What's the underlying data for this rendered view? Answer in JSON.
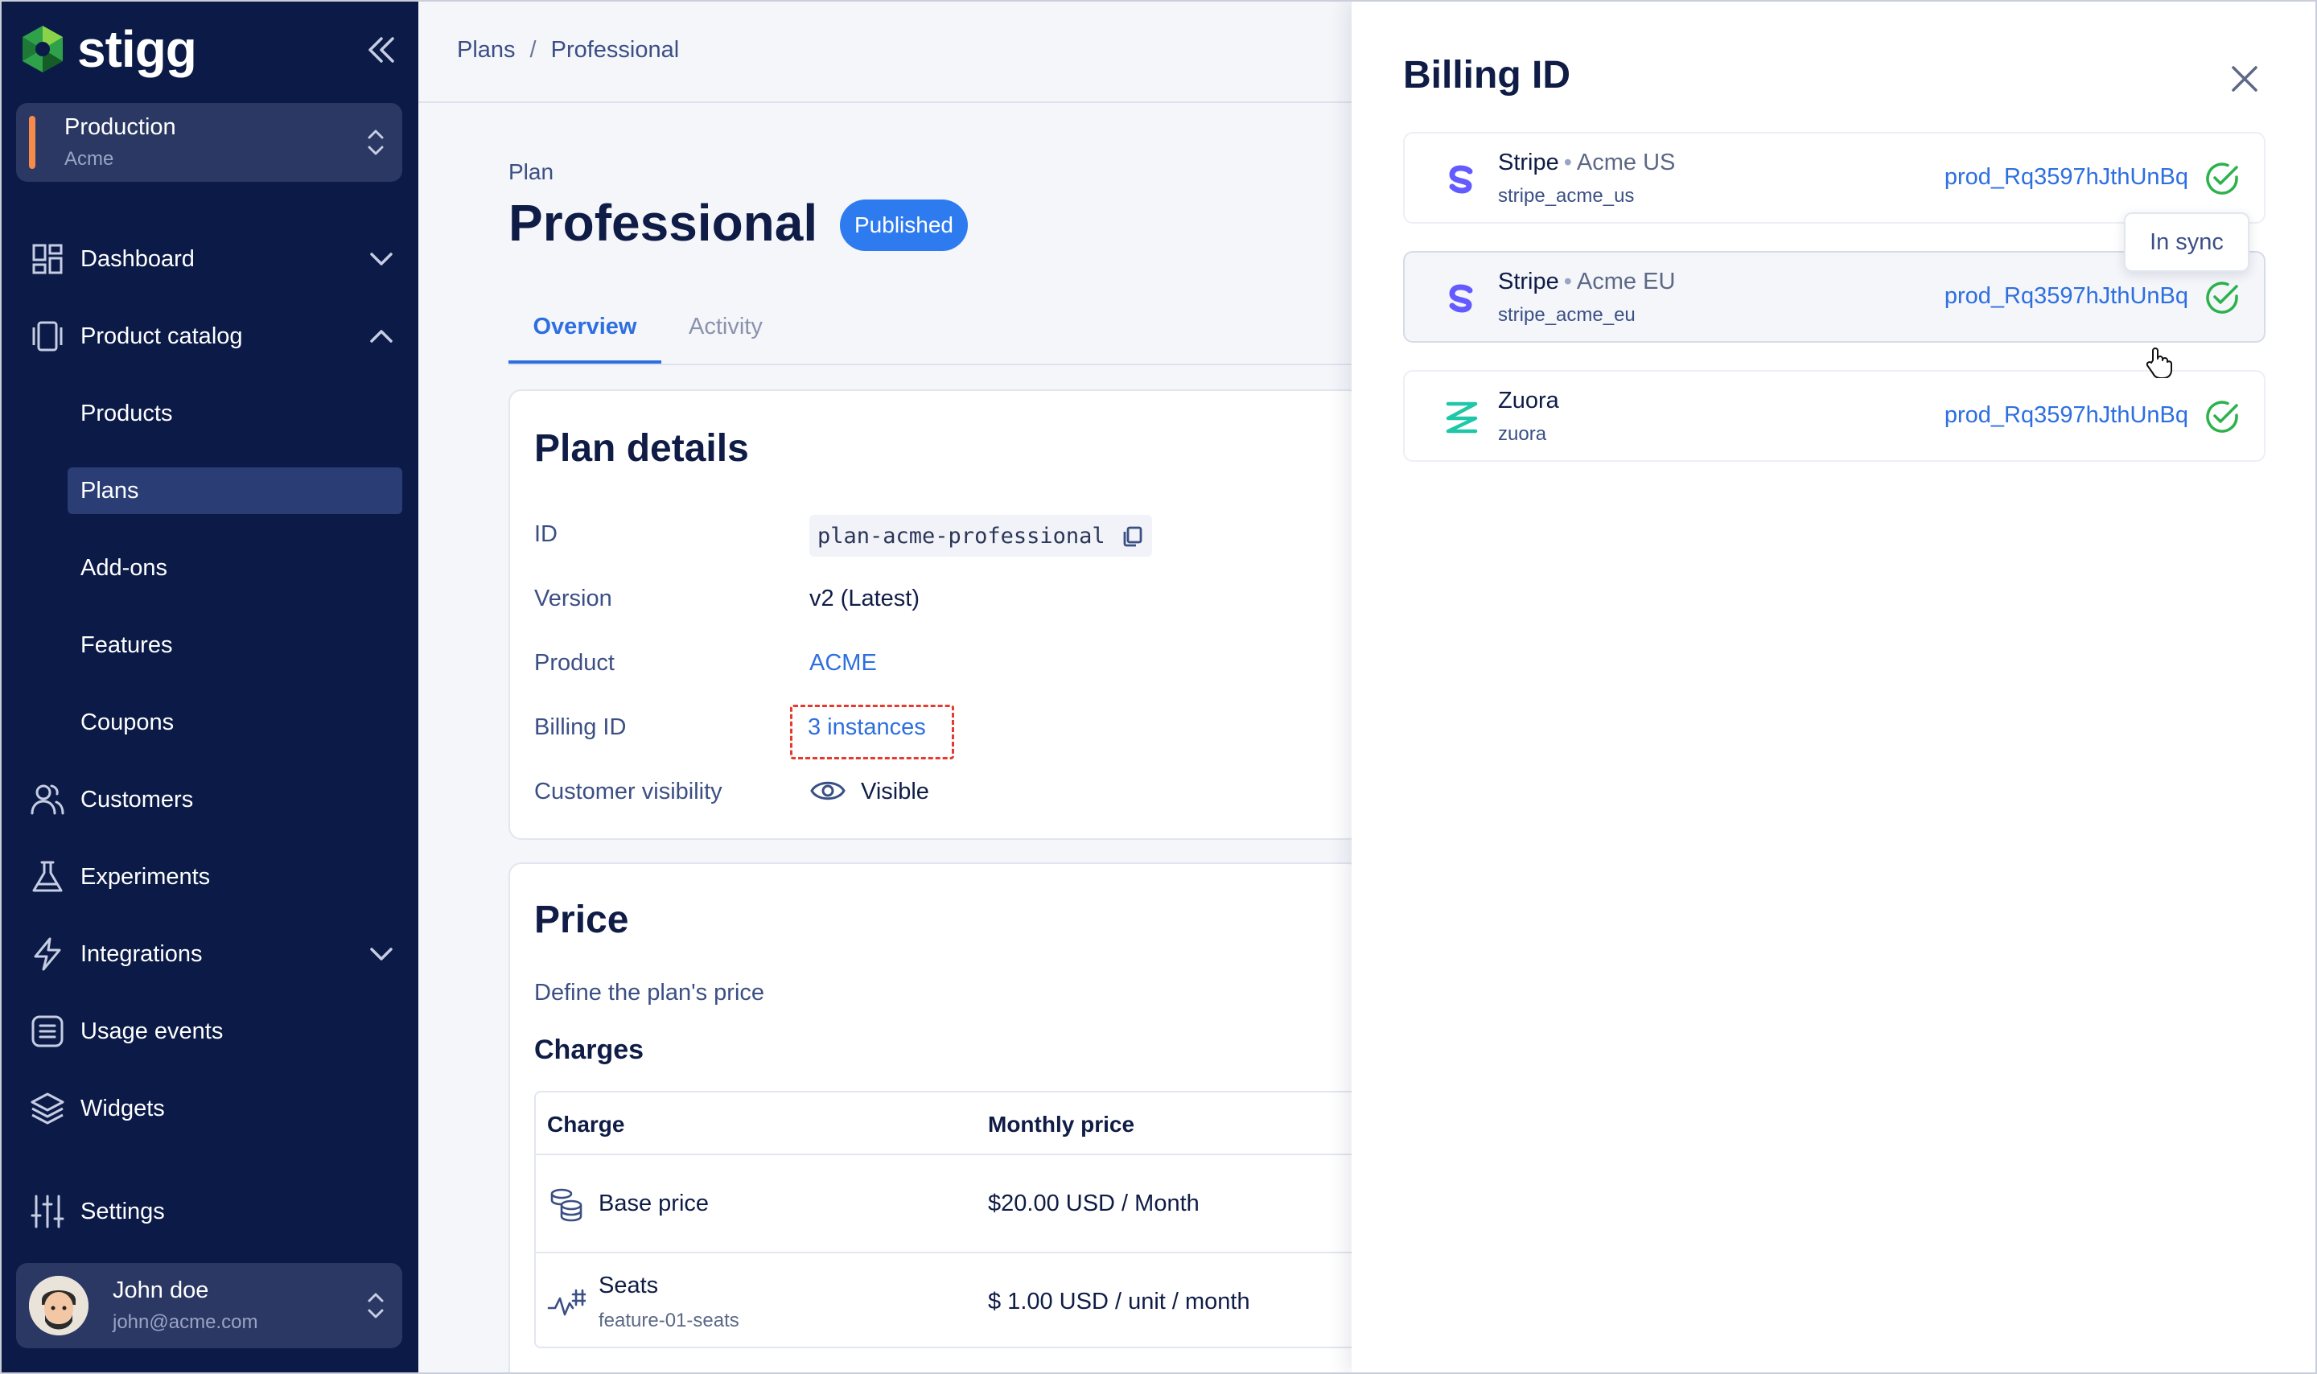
{
  "brand": {
    "name": "stigg",
    "logo": "stigg-logo"
  },
  "environment": {
    "name": "Production",
    "org": "Acme",
    "accent": "#f58a4b"
  },
  "nav": {
    "dashboard": "Dashboard",
    "product_catalog": "Product catalog",
    "products": "Products",
    "plans": "Plans",
    "addons": "Add-ons",
    "features": "Features",
    "coupons": "Coupons",
    "customers": "Customers",
    "experiments": "Experiments",
    "integrations": "Integrations",
    "usage_events": "Usage events",
    "widgets": "Widgets",
    "settings": "Settings"
  },
  "user": {
    "name": "John doe",
    "email": "john@acme.com"
  },
  "breadcrumb": {
    "root": "Plans",
    "sep": "/",
    "current": "Professional"
  },
  "plan": {
    "label": "Plan",
    "title": "Professional",
    "status": "Published",
    "tabs": [
      "Overview",
      "Activity"
    ]
  },
  "plan_details": {
    "title": "Plan details",
    "rows": {
      "id_label": "ID",
      "id_value": "plan-acme-professional",
      "version_label": "Version",
      "version_value": "v2 (Latest)",
      "product_label": "Product",
      "product_value": "ACME",
      "billing_label": "Billing ID",
      "billing_value": "3 instances",
      "visibility_label": "Customer visibility",
      "visibility_value": "Visible"
    }
  },
  "price": {
    "title": "Price",
    "subtitle": "Define the plan's price",
    "charges_title": "Charges",
    "headers": {
      "charge": "Charge",
      "monthly": "Monthly price"
    },
    "rows": [
      {
        "name": "Base price",
        "sub": "",
        "price": "$20.00 USD / Month",
        "icon": "coins-icon"
      },
      {
        "name": "Seats",
        "sub": "feature-01-seats",
        "price": "$ 1.00 USD / unit / month",
        "icon": "usage-icon"
      }
    ]
  },
  "drawer": {
    "title": "Billing ID",
    "tooltip": "In sync",
    "integrations": [
      {
        "vendor": "Stripe",
        "dot": "•",
        "account": "Acme US",
        "id": "stripe_acme_us",
        "link": "prod_Rq3597hJthUnBq",
        "icon": "stripe-icon"
      },
      {
        "vendor": "Stripe",
        "dot": "•",
        "account": "Acme EU",
        "id": "stripe_acme_eu",
        "link": "prod_Rq3597hJthUnBq",
        "icon": "stripe-icon"
      },
      {
        "vendor": "Zuora",
        "dot": "",
        "account": "",
        "id": "zuora",
        "link": "prod_Rq3597hJthUnBq",
        "icon": "zuora-icon"
      }
    ]
  },
  "colors": {
    "sidebar": "#0b1a47",
    "accent": "#2e7bf0",
    "link": "#2e6fe0",
    "success": "#2bb24c",
    "stripe": "#635bff",
    "zuora": "#1fc7a8",
    "dashed": "#e63a2e"
  }
}
